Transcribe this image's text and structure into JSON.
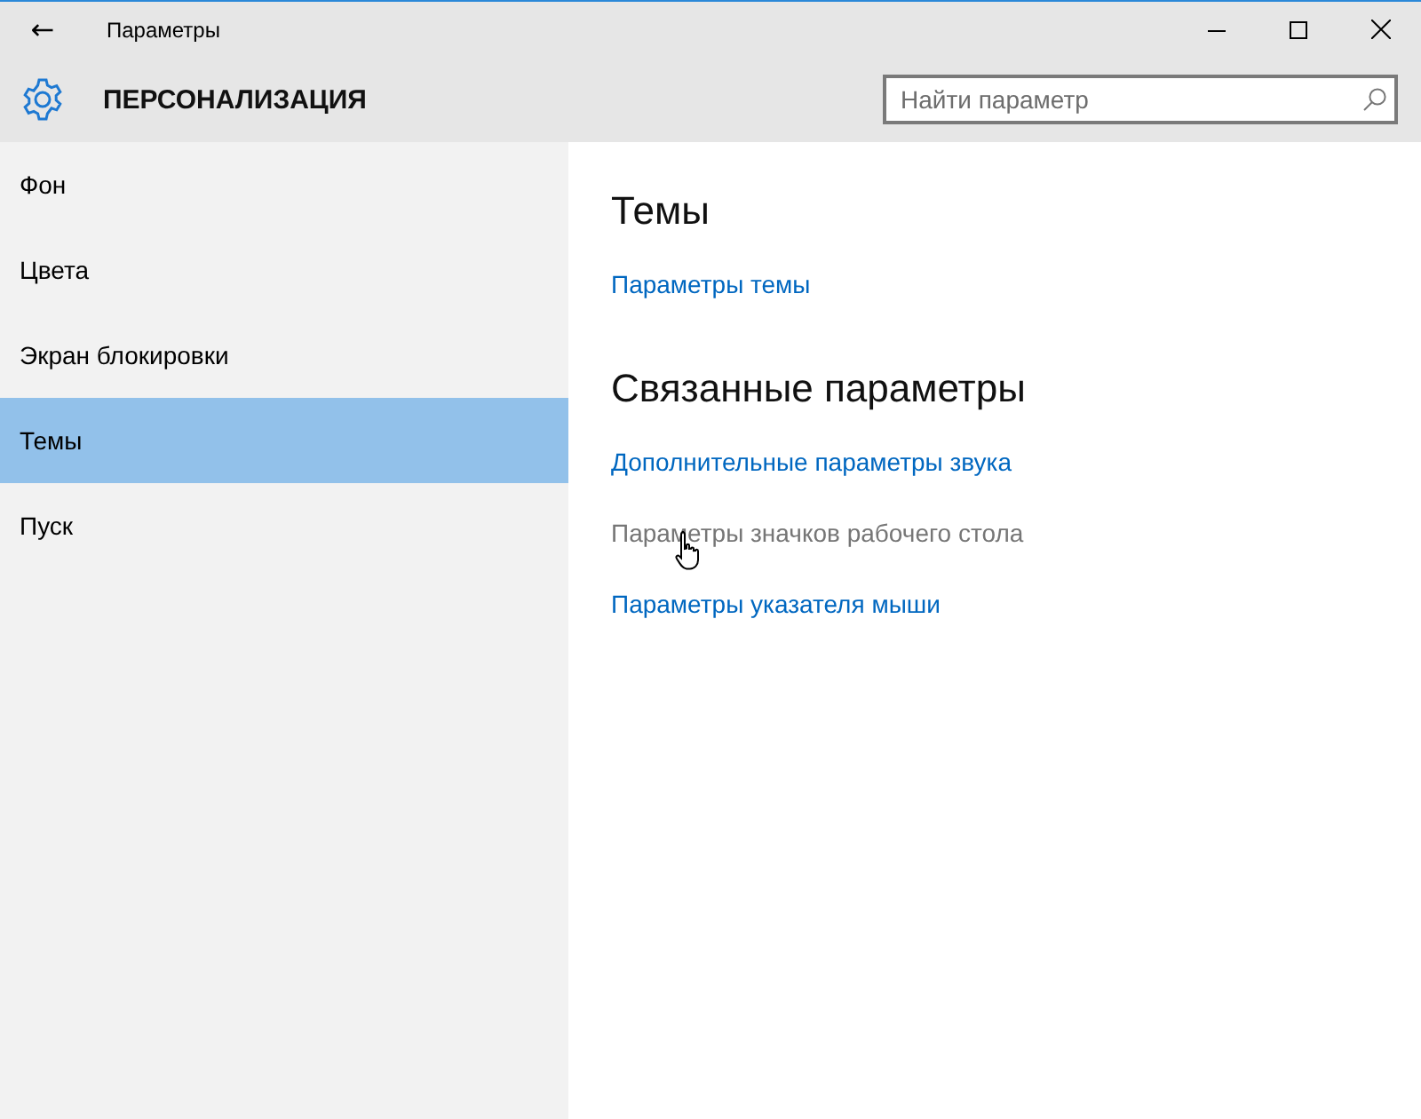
{
  "window": {
    "title": "Параметры",
    "back": "←"
  },
  "header": {
    "title": "ПЕРСОНАЛИЗАЦИЯ",
    "search": {
      "placeholder": "Найти параметр"
    }
  },
  "sidebar": {
    "items": [
      {
        "label": "Фон",
        "selected": false
      },
      {
        "label": "Цвета",
        "selected": false
      },
      {
        "label": "Экран блокировки",
        "selected": false
      },
      {
        "label": "Темы",
        "selected": true
      },
      {
        "label": "Пуск",
        "selected": false
      }
    ]
  },
  "content": {
    "sections": [
      {
        "title": "Темы",
        "links": [
          {
            "label": "Параметры темы",
            "hovered": false
          }
        ]
      },
      {
        "title": "Связанные параметры",
        "links": [
          {
            "label": "Дополнительные параметры звука",
            "hovered": false
          },
          {
            "label": "Параметры значков рабочего стола",
            "hovered": true
          },
          {
            "label": "Параметры указателя мыши",
            "hovered": false
          }
        ]
      }
    ]
  }
}
